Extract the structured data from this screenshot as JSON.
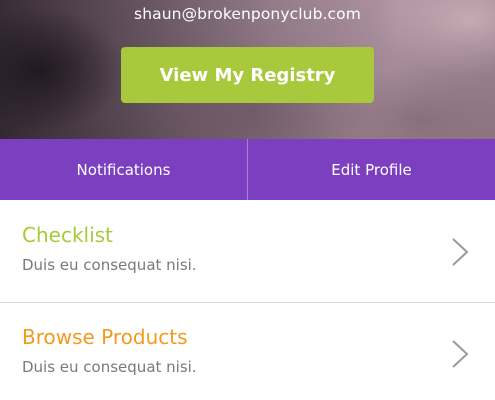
{
  "header": {
    "email": "shaun@brokenponyclub.com",
    "registry_button": "View My Registry"
  },
  "tabs": [
    {
      "label": "Notifications"
    },
    {
      "label": "Edit Profile"
    }
  ],
  "list": [
    {
      "title": "Checklist",
      "subtitle": "Duis eu consequat nisi.",
      "title_color": "#a7c93b",
      "icon": "chevron-right-icon"
    },
    {
      "title": "Browse Products",
      "subtitle": "Duis eu consequat nisi.",
      "title_color": "#f39a1f",
      "icon": "chevron-right-icon"
    }
  ],
  "colors": {
    "accent_green": "#a7c93b",
    "tab_purple": "#7b3fc0",
    "accent_orange": "#f39a1f"
  }
}
